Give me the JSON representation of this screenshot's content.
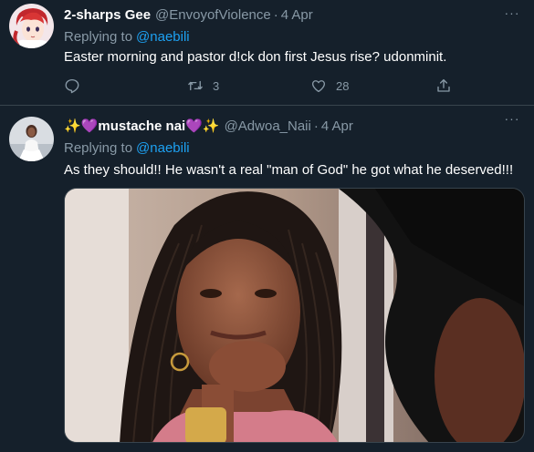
{
  "tweets": [
    {
      "display_name": "2-sharps Gee",
      "handle": "@EnvoyofViolence",
      "separator": "·",
      "date": "4 Apr",
      "replying_prefix": "Replying to",
      "replying_to": "@naebili",
      "text": "Easter morning and pastor d!ck don first Jesus rise? udonminit.",
      "avatar_icon": "anime-avatar-icon",
      "more_icon": "more-horizontal-icon",
      "more_glyph": "···",
      "actions": {
        "reply": {
          "icon": "reply-icon",
          "count": ""
        },
        "retweet": {
          "icon": "retweet-icon",
          "count": "3"
        },
        "like": {
          "icon": "heart-icon",
          "count": "28"
        },
        "share": {
          "icon": "share-icon"
        }
      }
    },
    {
      "display_name": "✨💜mustache nai💜✨",
      "handle": "@Adwoa_Naii",
      "separator": "·",
      "date": "4 Apr",
      "replying_prefix": "Replying to",
      "replying_to": "@naebili",
      "text": "As they should!! He wasn't a real \"man of God\" he got what he deserved!!!",
      "avatar_icon": "photo-avatar-icon",
      "more_icon": "more-horizontal-icon",
      "more_glyph": "···",
      "media_icon": "attached-photo"
    }
  ],
  "colors": {
    "background": "#15202b",
    "border": "#38444d",
    "secondary_text": "#8899a6",
    "primary_text": "#ffffff",
    "accent": "#1da1f2"
  }
}
